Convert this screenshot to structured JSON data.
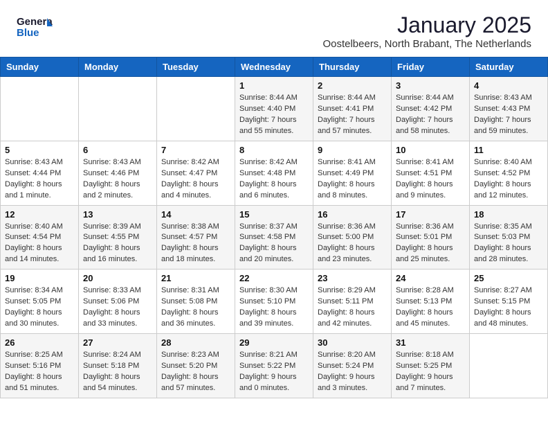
{
  "header": {
    "logo_line1": "General",
    "logo_line2": "Blue",
    "month_year": "January 2025",
    "location": "Oostelbeers, North Brabant, The Netherlands"
  },
  "weekdays": [
    "Sunday",
    "Monday",
    "Tuesday",
    "Wednesday",
    "Thursday",
    "Friday",
    "Saturday"
  ],
  "weeks": [
    [
      {
        "day": "",
        "info": ""
      },
      {
        "day": "",
        "info": ""
      },
      {
        "day": "",
        "info": ""
      },
      {
        "day": "1",
        "info": "Sunrise: 8:44 AM\nSunset: 4:40 PM\nDaylight: 7 hours\nand 55 minutes."
      },
      {
        "day": "2",
        "info": "Sunrise: 8:44 AM\nSunset: 4:41 PM\nDaylight: 7 hours\nand 57 minutes."
      },
      {
        "day": "3",
        "info": "Sunrise: 8:44 AM\nSunset: 4:42 PM\nDaylight: 7 hours\nand 58 minutes."
      },
      {
        "day": "4",
        "info": "Sunrise: 8:43 AM\nSunset: 4:43 PM\nDaylight: 7 hours\nand 59 minutes."
      }
    ],
    [
      {
        "day": "5",
        "info": "Sunrise: 8:43 AM\nSunset: 4:44 PM\nDaylight: 8 hours\nand 1 minute."
      },
      {
        "day": "6",
        "info": "Sunrise: 8:43 AM\nSunset: 4:46 PM\nDaylight: 8 hours\nand 2 minutes."
      },
      {
        "day": "7",
        "info": "Sunrise: 8:42 AM\nSunset: 4:47 PM\nDaylight: 8 hours\nand 4 minutes."
      },
      {
        "day": "8",
        "info": "Sunrise: 8:42 AM\nSunset: 4:48 PM\nDaylight: 8 hours\nand 6 minutes."
      },
      {
        "day": "9",
        "info": "Sunrise: 8:41 AM\nSunset: 4:49 PM\nDaylight: 8 hours\nand 8 minutes."
      },
      {
        "day": "10",
        "info": "Sunrise: 8:41 AM\nSunset: 4:51 PM\nDaylight: 8 hours\nand 9 minutes."
      },
      {
        "day": "11",
        "info": "Sunrise: 8:40 AM\nSunset: 4:52 PM\nDaylight: 8 hours\nand 12 minutes."
      }
    ],
    [
      {
        "day": "12",
        "info": "Sunrise: 8:40 AM\nSunset: 4:54 PM\nDaylight: 8 hours\nand 14 minutes."
      },
      {
        "day": "13",
        "info": "Sunrise: 8:39 AM\nSunset: 4:55 PM\nDaylight: 8 hours\nand 16 minutes."
      },
      {
        "day": "14",
        "info": "Sunrise: 8:38 AM\nSunset: 4:57 PM\nDaylight: 8 hours\nand 18 minutes."
      },
      {
        "day": "15",
        "info": "Sunrise: 8:37 AM\nSunset: 4:58 PM\nDaylight: 8 hours\nand 20 minutes."
      },
      {
        "day": "16",
        "info": "Sunrise: 8:36 AM\nSunset: 5:00 PM\nDaylight: 8 hours\nand 23 minutes."
      },
      {
        "day": "17",
        "info": "Sunrise: 8:36 AM\nSunset: 5:01 PM\nDaylight: 8 hours\nand 25 minutes."
      },
      {
        "day": "18",
        "info": "Sunrise: 8:35 AM\nSunset: 5:03 PM\nDaylight: 8 hours\nand 28 minutes."
      }
    ],
    [
      {
        "day": "19",
        "info": "Sunrise: 8:34 AM\nSunset: 5:05 PM\nDaylight: 8 hours\nand 30 minutes."
      },
      {
        "day": "20",
        "info": "Sunrise: 8:33 AM\nSunset: 5:06 PM\nDaylight: 8 hours\nand 33 minutes."
      },
      {
        "day": "21",
        "info": "Sunrise: 8:31 AM\nSunset: 5:08 PM\nDaylight: 8 hours\nand 36 minutes."
      },
      {
        "day": "22",
        "info": "Sunrise: 8:30 AM\nSunset: 5:10 PM\nDaylight: 8 hours\nand 39 minutes."
      },
      {
        "day": "23",
        "info": "Sunrise: 8:29 AM\nSunset: 5:11 PM\nDaylight: 8 hours\nand 42 minutes."
      },
      {
        "day": "24",
        "info": "Sunrise: 8:28 AM\nSunset: 5:13 PM\nDaylight: 8 hours\nand 45 minutes."
      },
      {
        "day": "25",
        "info": "Sunrise: 8:27 AM\nSunset: 5:15 PM\nDaylight: 8 hours\nand 48 minutes."
      }
    ],
    [
      {
        "day": "26",
        "info": "Sunrise: 8:25 AM\nSunset: 5:16 PM\nDaylight: 8 hours\nand 51 minutes."
      },
      {
        "day": "27",
        "info": "Sunrise: 8:24 AM\nSunset: 5:18 PM\nDaylight: 8 hours\nand 54 minutes."
      },
      {
        "day": "28",
        "info": "Sunrise: 8:23 AM\nSunset: 5:20 PM\nDaylight: 8 hours\nand 57 minutes."
      },
      {
        "day": "29",
        "info": "Sunrise: 8:21 AM\nSunset: 5:22 PM\nDaylight: 9 hours\nand 0 minutes."
      },
      {
        "day": "30",
        "info": "Sunrise: 8:20 AM\nSunset: 5:24 PM\nDaylight: 9 hours\nand 3 minutes."
      },
      {
        "day": "31",
        "info": "Sunrise: 8:18 AM\nSunset: 5:25 PM\nDaylight: 9 hours\nand 7 minutes."
      },
      {
        "day": "",
        "info": ""
      }
    ]
  ]
}
